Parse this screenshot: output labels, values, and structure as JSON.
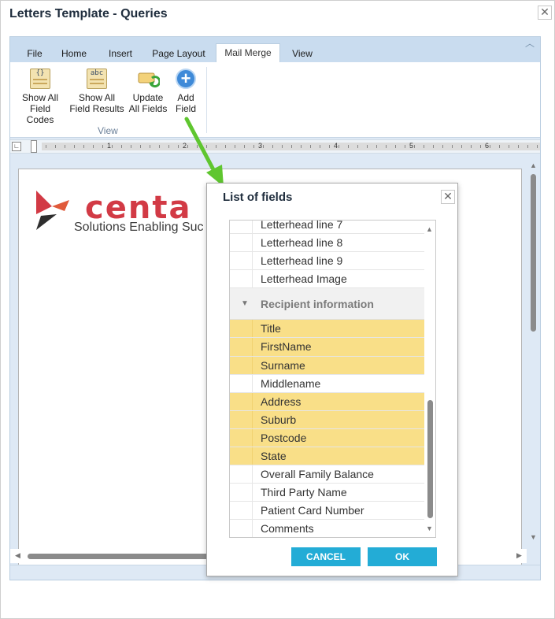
{
  "window": {
    "title": "Letters Template - Queries",
    "close_glyph": "✕"
  },
  "ribbon": {
    "tabs": [
      {
        "label": "File"
      },
      {
        "label": "Home"
      },
      {
        "label": "Insert"
      },
      {
        "label": "Page Layout"
      },
      {
        "label": "Mail Merge",
        "active": true
      },
      {
        "label": "View"
      }
    ],
    "buttons": {
      "show_codes": {
        "line1": "Show All",
        "line2": "Field Codes",
        "icon": "field-codes-icon",
        "glyph": "{}"
      },
      "show_results": {
        "line1": "Show All",
        "line2": "Field Results",
        "icon": "field-results-icon",
        "glyph": "abc"
      },
      "update": {
        "line1": "Update",
        "line2": "All Fields",
        "icon": "update-fields-icon"
      },
      "add": {
        "line1": "Add",
        "line2": "Field",
        "icon": "add-field-icon",
        "glyph": "+"
      }
    },
    "group_label": "View"
  },
  "ruler": {
    "numbers": [
      "1",
      "2",
      "3",
      "4",
      "5",
      "6"
    ]
  },
  "document": {
    "logo_word": "centa",
    "logo_tagline": "Solutions Enabling Suc"
  },
  "dialog": {
    "title": "List of fields",
    "close_glyph": "✕",
    "rows": [
      {
        "label": "Letterhead line 7",
        "highlight": false
      },
      {
        "label": "Letterhead line 8",
        "highlight": false
      },
      {
        "label": "Letterhead line 9",
        "highlight": false
      },
      {
        "label": "Letterhead Image",
        "highlight": false
      },
      {
        "label": "Recipient information",
        "group": true
      },
      {
        "label": "Title",
        "highlight": true
      },
      {
        "label": "FirstName",
        "highlight": true
      },
      {
        "label": "Surname",
        "highlight": true
      },
      {
        "label": "Middlename",
        "highlight": false
      },
      {
        "label": "Address",
        "highlight": true
      },
      {
        "label": "Suburb",
        "highlight": true
      },
      {
        "label": "Postcode",
        "highlight": true
      },
      {
        "label": "State",
        "highlight": true
      },
      {
        "label": "Overall Family Balance",
        "highlight": false
      },
      {
        "label": "Third Party Name",
        "highlight": false
      },
      {
        "label": "Patient Card Number",
        "highlight": false
      },
      {
        "label": "Comments",
        "highlight": false
      }
    ],
    "cancel_label": "CANCEL",
    "ok_label": "OK"
  },
  "colors": {
    "highlight_row": "#f9df88",
    "button": "#23acd6",
    "arrow": "#5fc62f",
    "logo_red": "#d23a45"
  }
}
